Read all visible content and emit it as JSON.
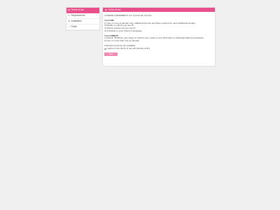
{
  "sidebar": {
    "items": [
      {
        "label": "Terms of use",
        "icon": "document-icon",
        "active": true
      },
      {
        "label": "Requirements",
        "icon": "list-icon",
        "active": false
      },
      {
        "label": "Installation",
        "icon": "gear-icon",
        "active": false
      },
      {
        "label": "Finish",
        "icon": "check-icon",
        "active": false
      }
    ]
  },
  "panel": {
    "title": "Terms of use",
    "lines": {
      "license_title": "LICENSE AGREEMENT: one (1) Domain Licence",
      "you_can_heading": "You CAN:",
      "can_1": "1) Use on one (1) domain only, additional license purchase required for each additional domain;",
      "can_2": "2) Modify or edit as you see fit;",
      "can_3": "3) Delete sections as you see fit;",
      "can_4": "4) Translate to your choice of language.",
      "you_cannot_heading": "You CANNOT:",
      "cannot_1": "1) Resell, distribute, give away or trade by any means to any third party or individual without permission;",
      "cannot_2": "2) Use on more than one (1) domain.",
      "unlimited": "Unlimited Licenses are available.",
      "agree": "I agree to the terms of use and privacy policy"
    },
    "button_label": "Next"
  },
  "colors": {
    "accent": "#e94f8b",
    "button": "#f08ab2",
    "background": "#f0f0f0"
  }
}
